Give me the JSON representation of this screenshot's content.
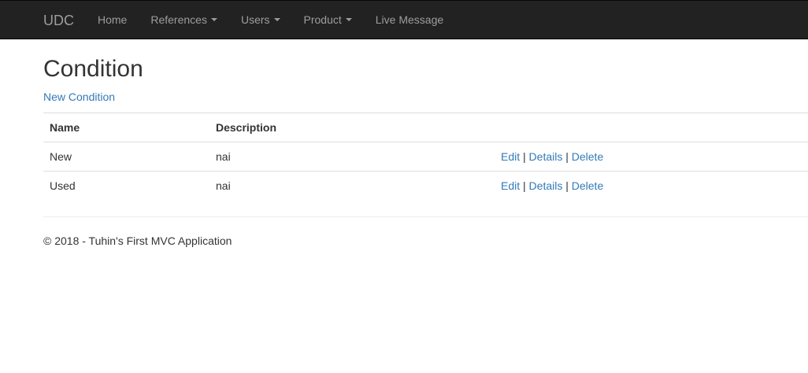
{
  "navbar": {
    "brand": "UDC",
    "items": [
      {
        "label": "Home",
        "dropdown": false
      },
      {
        "label": "References",
        "dropdown": true
      },
      {
        "label": "Users",
        "dropdown": true
      },
      {
        "label": "Product",
        "dropdown": true
      },
      {
        "label": "Live Message",
        "dropdown": false
      }
    ]
  },
  "main": {
    "title": "Condition",
    "create_link": "New Condition",
    "table": {
      "headers": [
        "Name",
        "Description"
      ],
      "rows": [
        {
          "name": "New",
          "description": "nai"
        },
        {
          "name": "Used",
          "description": "nai"
        }
      ],
      "actions": {
        "edit": "Edit",
        "details": "Details",
        "delete": "Delete",
        "separator": "|"
      }
    }
  },
  "footer": {
    "text": "© 2018 - Tuhin's First MVC Application"
  },
  "colors": {
    "navbar_bg": "#222222",
    "navbar_text": "#9d9d9d",
    "link": "#337ab7",
    "text": "#333333"
  }
}
